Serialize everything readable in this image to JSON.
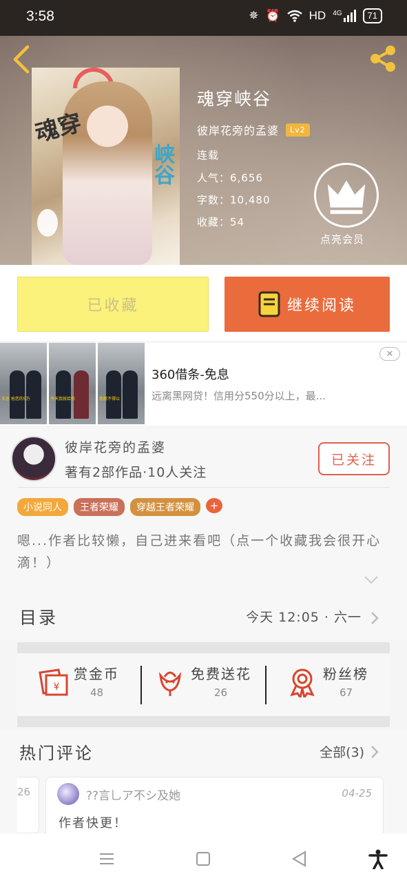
{
  "status_bar": {
    "time": "3:58",
    "network": "HD",
    "signal": "4G",
    "battery": "71"
  },
  "book": {
    "title": "魂穿峡谷",
    "author": "彼岸花旁的孟婆",
    "level": "Lv2",
    "status": "连载",
    "popularity": "人气：6,656",
    "word_count": "字数：10,480",
    "favorites": "收藏：54",
    "cover_text_1": "魂穿",
    "cover_text_2": "峡谷",
    "vip_label": "点亮会员"
  },
  "actions": {
    "favorited_label": "已收藏",
    "continue_label": "继续阅读"
  },
  "ad": {
    "title": "360借条-免息",
    "description": "远离黑网贷！信用分550分以上，最...",
    "close": "✕",
    "thumb_captions": [
      "王总 抢您的5万",
      "今天我就给你",
      "我就不得以"
    ]
  },
  "author_card": {
    "name": "彼岸花旁的孟婆",
    "stats": "著有2部作品·10人关注",
    "follow_label": "已关注",
    "tags": [
      {
        "label": "小说同人",
        "color": "#f3a83b"
      },
      {
        "label": "王者荣耀",
        "color": "#c9715a"
      },
      {
        "label": "穿越王者荣耀",
        "color": "#d3913f"
      }
    ],
    "tag_more": "+",
    "intro": "嗯...作者比较懒，自己进来看吧（点一个收藏我会很开心滴！）"
  },
  "toc": {
    "title": "目录",
    "latest": "今天 12:05 · 六一"
  },
  "stats": {
    "reward": {
      "label": "赏金币",
      "count": "48"
    },
    "flowers": {
      "label": "免费送花",
      "count": "26"
    },
    "fans": {
      "label": "粉丝榜",
      "count": "67"
    }
  },
  "comments": {
    "title": "热门评论",
    "all_label": "全部(3)",
    "prev_date_fragment": "26",
    "items": [
      {
        "user": "??言乚ア不シ及她",
        "date": "04-25",
        "text": "作者快更！"
      }
    ]
  },
  "colors": {
    "accent": "#ea6c3d",
    "favorite_bg": "#fbf27b",
    "follow": "#e05f4e",
    "icon_red": "#d9452f"
  }
}
